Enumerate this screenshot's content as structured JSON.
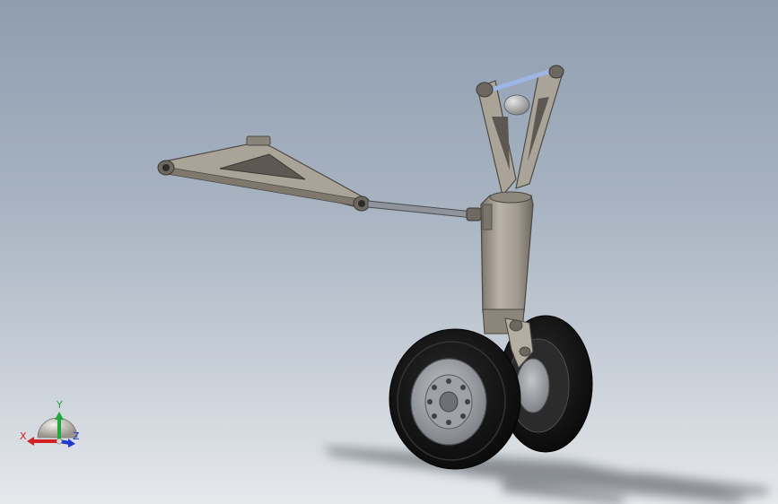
{
  "triad": {
    "x_label": "X",
    "y_label": "Y",
    "z_label": "Z",
    "x_color": "#d42020",
    "y_color": "#1fa83a",
    "z_color": "#1f3ccc"
  },
  "colors": {
    "metal": "#a59e92",
    "metal_dark": "#6f6960",
    "tire": "#151515",
    "rod": "#9aa0a8",
    "pivot_rod": "#9db6e6"
  }
}
